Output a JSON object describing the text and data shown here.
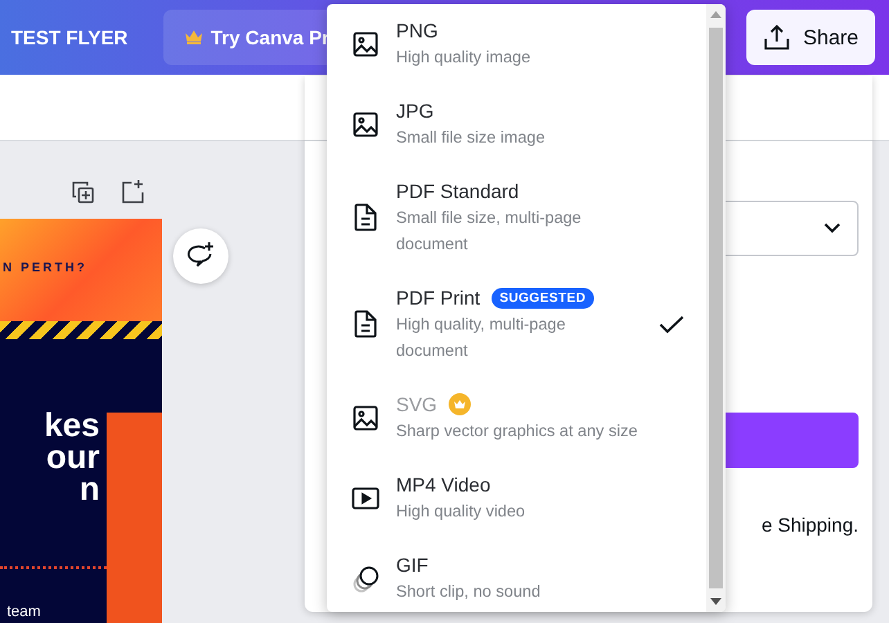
{
  "topbar": {
    "title": "TEST FLYER",
    "pro_button": "Try Canva Pr",
    "share_button": "Share"
  },
  "flyer": {
    "tagline": "N PERTH?",
    "headline": [
      "kes",
      "our",
      "n"
    ],
    "footer": "team"
  },
  "panel": {
    "note": "e Shipping."
  },
  "menu": {
    "items": [
      {
        "kind": "image",
        "label": "PNG",
        "description": "High quality image",
        "disabled": false,
        "pro": false,
        "selected": false
      },
      {
        "kind": "image",
        "label": "JPG",
        "description": "Small file size image",
        "disabled": false,
        "pro": false,
        "selected": false
      },
      {
        "kind": "document",
        "label": "PDF Standard",
        "description": "Small file size, multi-page document",
        "disabled": false,
        "pro": false,
        "selected": false
      },
      {
        "kind": "document",
        "label": "PDF Print",
        "badge": "SUGGESTED",
        "description": "High quality, multi-page document",
        "disabled": false,
        "pro": false,
        "selected": true
      },
      {
        "kind": "image",
        "label": "SVG",
        "description": "Sharp vector graphics at any size",
        "disabled": true,
        "pro": true,
        "selected": false
      },
      {
        "kind": "video",
        "label": "MP4 Video",
        "description": "High quality video",
        "disabled": false,
        "pro": false,
        "selected": false
      },
      {
        "kind": "gif",
        "label": "GIF",
        "description": "Short clip, no sound",
        "disabled": false,
        "pro": false,
        "selected": false
      }
    ]
  }
}
